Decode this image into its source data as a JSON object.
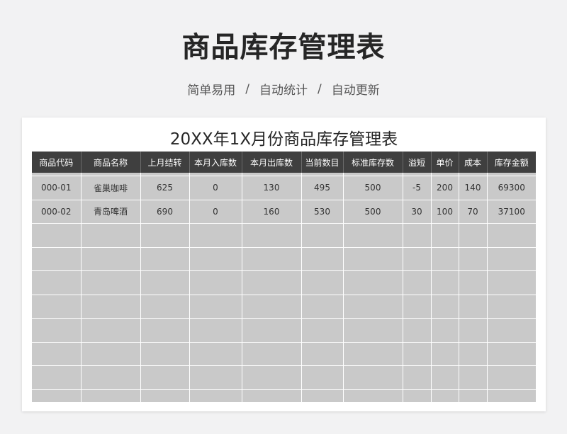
{
  "page": {
    "title": "商品库存管理表",
    "subtitle_items": [
      "简单易用",
      "自动统计",
      "自动更新"
    ],
    "separator": "/"
  },
  "sheet": {
    "title": "20XX年1X月份商品库存管理表",
    "columns": [
      "商品代码",
      "商品名称",
      "上月结转",
      "本月入库数",
      "本月出库数",
      "当前数目",
      "标准库存数",
      "溢短",
      "单价",
      "成本",
      "库存金额"
    ],
    "rows": [
      [
        "000-01",
        "雀巢咖啡",
        "625",
        "0",
        "130",
        "495",
        "500",
        "-5",
        "200",
        "140",
        "69300"
      ],
      [
        "000-02",
        "青岛啤酒",
        "690",
        "0",
        "160",
        "530",
        "500",
        "30",
        "100",
        "70",
        "37100"
      ]
    ],
    "empty_row_count": 8
  },
  "colors": {
    "header_bg": "#3f3f3f",
    "cell_bg": "#c9c9c9",
    "page_bg": "#f2f2f3"
  }
}
